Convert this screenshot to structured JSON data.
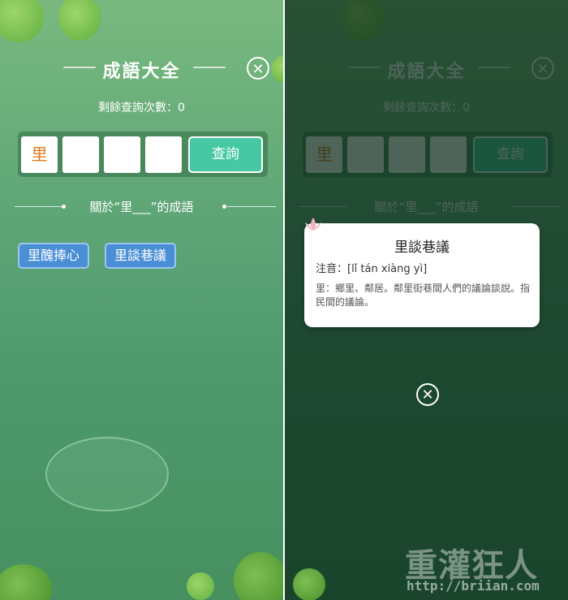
{
  "app": {
    "title": "成語大全",
    "remaining_label": "剩餘查詢次數：0"
  },
  "input": {
    "chars": [
      "里",
      "",
      "",
      ""
    ],
    "query_button": "查詢"
  },
  "about_label": "關於“里___”的成語",
  "results": [
    "里醜捧心",
    "里談巷議"
  ],
  "detail": {
    "title": "里談巷議",
    "pinyin": "注音：[lǐ tán xiàng yì]",
    "definition": "里：鄉里、鄰居。鄰里街巷間人們的議論談說。指民間的議論。"
  },
  "watermark": {
    "text": "重灌狂人",
    "url": "http://briian.com"
  },
  "colors": {
    "accent": "#46c9a3",
    "button_blue": "#4a8ed6",
    "char_orange": "#e07a1f"
  },
  "icons": {
    "close": "close-icon",
    "lotus": "lotus-icon"
  }
}
